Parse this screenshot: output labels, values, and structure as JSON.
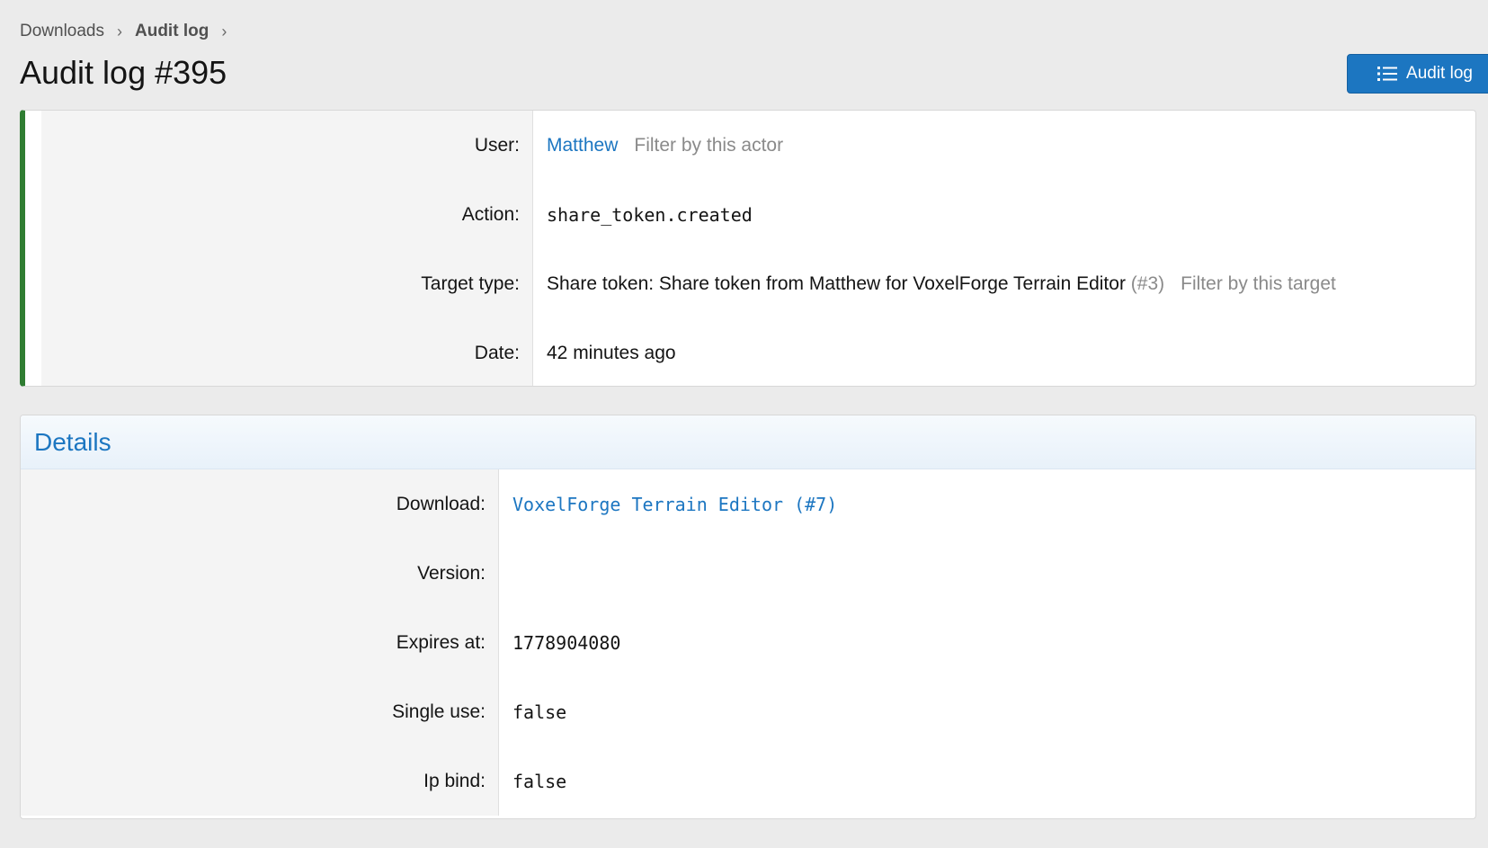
{
  "breadcrumb": {
    "items": [
      "Downloads",
      "Audit log"
    ]
  },
  "page": {
    "title": "Audit log #395",
    "audit_log_button": "Audit log"
  },
  "summary": {
    "user_label": "User:",
    "user_value": "Matthew",
    "user_filter": "Filter by this actor",
    "action_label": "Action:",
    "action_value": "share_token.created",
    "target_label": "Target type:",
    "target_value": "Share token: Share token from Matthew for VoxelForge Terrain Editor",
    "target_id": "(#3)",
    "target_filter": "Filter by this target",
    "date_label": "Date:",
    "date_value": "42 minutes ago"
  },
  "details": {
    "title": "Details",
    "rows": [
      {
        "label": "Download:",
        "value": "VoxelForge Terrain Editor (#7)"
      },
      {
        "label": "Version:",
        "value": ""
      },
      {
        "label": "Expires at:",
        "value": "1778904080"
      },
      {
        "label": "Single use:",
        "value": "false"
      },
      {
        "label": "Ip bind:",
        "value": "false"
      }
    ]
  },
  "colors": {
    "accent": "#1c76c1",
    "status_bar": "#2f7d32",
    "background": "#ebebeb"
  },
  "icons": {
    "audit_log_button": "list-icon",
    "breadcrumb_separator": "chevron-right-icon"
  }
}
